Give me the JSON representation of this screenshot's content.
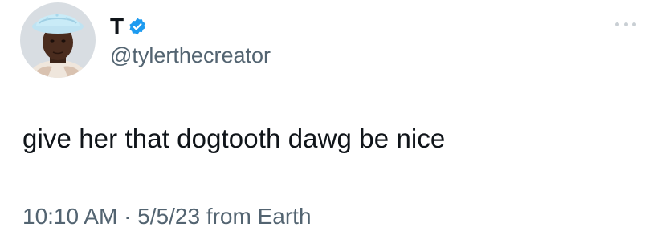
{
  "author": {
    "display_name": "T",
    "handle": "@tylerthecreator",
    "verified": true,
    "verified_icon": "verified-badge-icon",
    "verified_color": "#1d9bf0"
  },
  "menu": {
    "icon": "more-options-icon"
  },
  "tweet": {
    "text": "give her that dogtooth dawg be nice",
    "meta": "10:10 AM · 5/5/23 from Earth"
  },
  "colors": {
    "text_primary": "#0f1419",
    "text_secondary": "#536471",
    "background": "#ffffff"
  }
}
